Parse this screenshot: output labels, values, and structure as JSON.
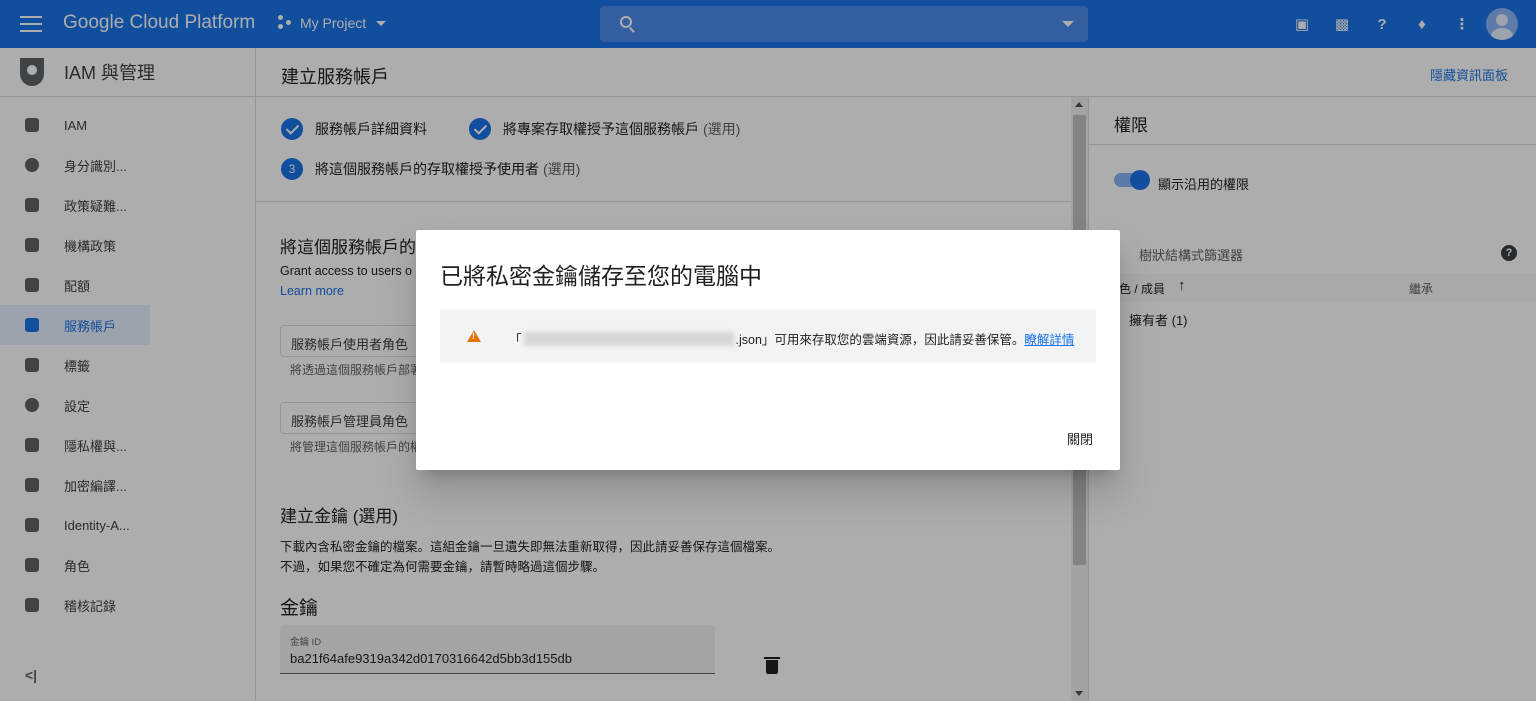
{
  "topbar": {
    "brand": "Google Cloud Platform",
    "project": "My Project",
    "search_placeholder": "",
    "icons": [
      "gift-icon",
      "cloud-shell-icon",
      "help-icon",
      "notifications-icon",
      "more-vert-icon",
      "avatar"
    ]
  },
  "sidebar": {
    "header": "IAM 與管理",
    "items": [
      {
        "label": "IAM",
        "icon": "person-add-icon"
      },
      {
        "label": "身分識別...",
        "icon": "account-circle-icon"
      },
      {
        "label": "政策疑難...",
        "icon": "wrench-icon"
      },
      {
        "label": "機構政策",
        "icon": "policy-doc-icon"
      },
      {
        "label": "配額",
        "icon": "quota-icon"
      },
      {
        "label": "服務帳戶",
        "icon": "service-account-icon",
        "active": true
      },
      {
        "label": "標籤",
        "icon": "tag-icon"
      },
      {
        "label": "設定",
        "icon": "settings-icon"
      },
      {
        "label": "隱私權與...",
        "icon": "privacy-shield-icon"
      },
      {
        "label": "加密編譯...",
        "icon": "encryption-shield-icon"
      },
      {
        "label": "Identity-A...",
        "icon": "identity-aware-icon"
      },
      {
        "label": "角色",
        "icon": "roles-hat-icon"
      },
      {
        "label": "稽核記錄",
        "icon": "audit-list-icon"
      }
    ],
    "collapse_label": "<|"
  },
  "main": {
    "title": "建立服務帳戶",
    "hide_panel": "隱藏資訊面板",
    "steps": [
      {
        "label": "服務帳戶詳細資料",
        "optional": ""
      },
      {
        "label": "將專案存取權授予這個服務帳戶",
        "optional": "(選用)"
      },
      {
        "num": "3",
        "label": "將這個服務帳戶的存取權授予使用者",
        "optional": "(選用)"
      }
    ],
    "grant_title": "將這個服務帳戶的",
    "grant_text": "Grant access to users o",
    "learn_more": "Learn more",
    "user_role_field": "服務帳戶使用者角色",
    "user_role_hint": "將透過這個服務帳戶部署",
    "admin_role_field": "服務帳戶管理員角色",
    "admin_role_hint": "將管理這個服務帳戶的權",
    "create_key_title": "建立金鑰 (選用)",
    "create_key_line1": "下載內含私密金鑰的檔案。這組金鑰一旦遺失即無法重新取得，因此請妥善保存這個檔案。",
    "create_key_line2": "不過，如果您不確定為何需要金鑰，請暫時略過這個步驟。",
    "keys_title": "金鑰",
    "key_id_label": "金鑰 ID",
    "key_id_value": "ba21f64afe9319a342d0170316642d5bb3d155db"
  },
  "right_panel": {
    "title": "權限",
    "toggle_label": "顯示沿用的權限",
    "tree_filter": "樹狀結構式篩選器",
    "col_role": "色 / 成員",
    "col_inherit": "繼承",
    "row1": "擁有者 (1)"
  },
  "dialog": {
    "title": "已將私密金鑰儲存至您的電腦中",
    "msg_prefix": "「",
    "msg_suffix": ".json」可用來存取您的雲端資源，因此請妥善保管。",
    "msg_link": "瞭解詳情",
    "close": "關閉"
  }
}
